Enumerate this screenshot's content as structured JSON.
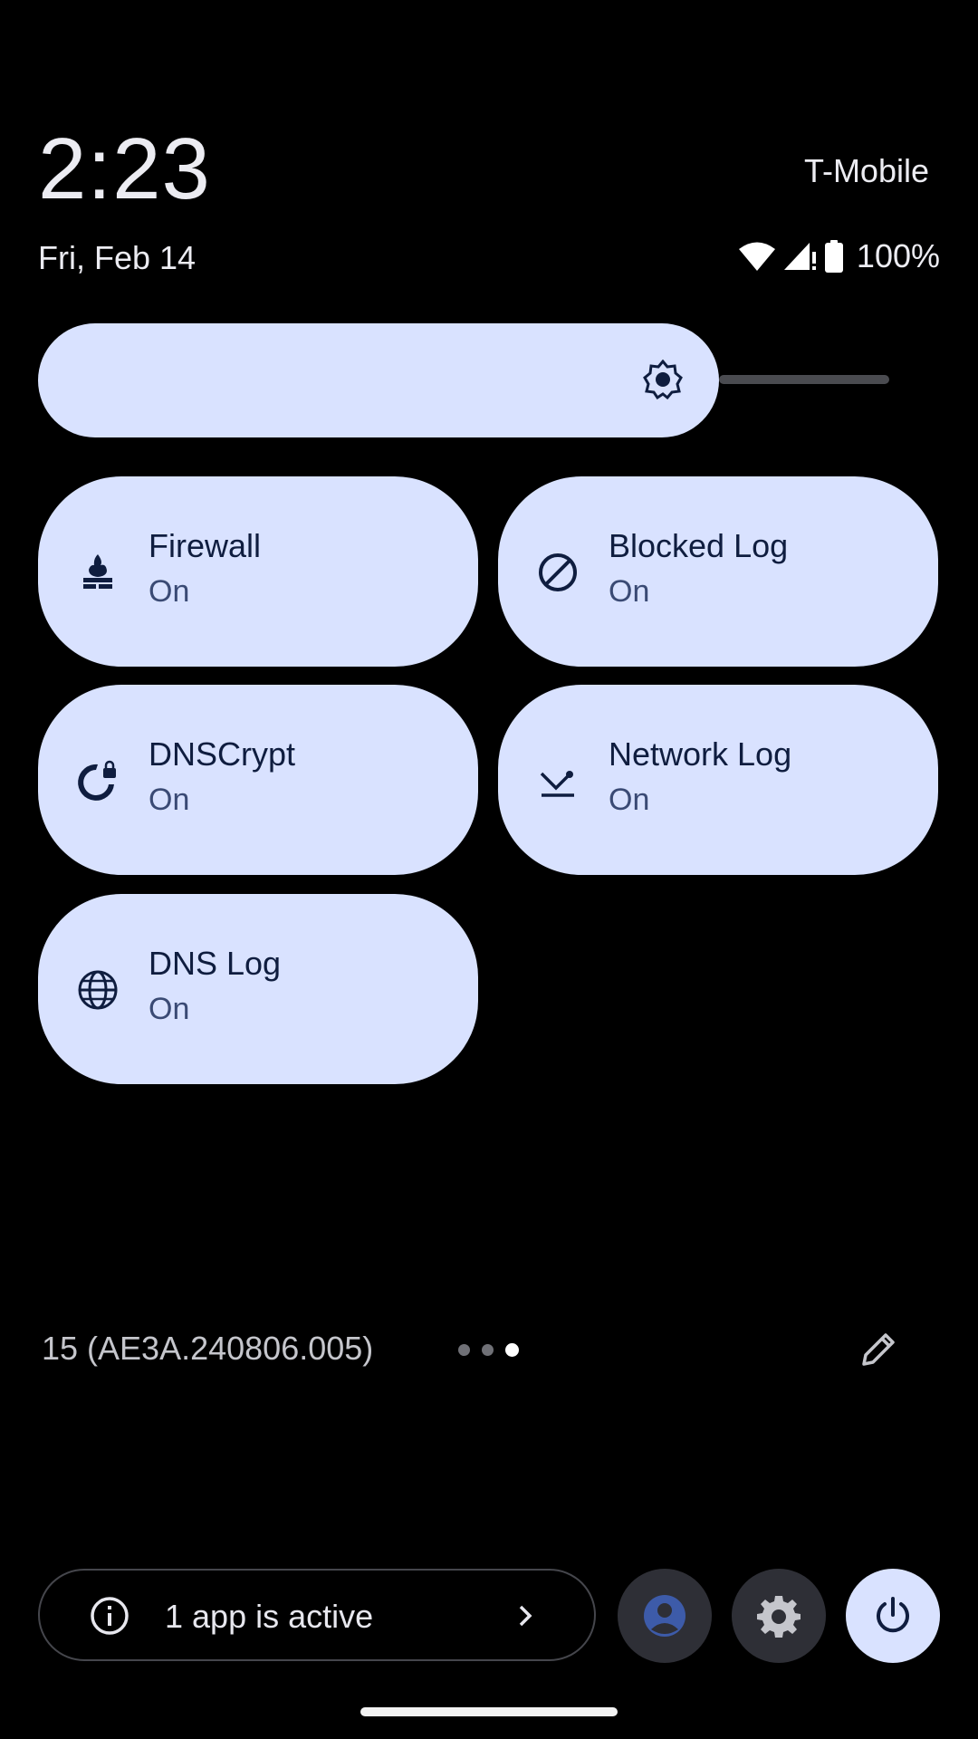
{
  "status": {
    "time": "2:23",
    "date": "Fri, Feb 14",
    "carrier": "T-Mobile",
    "battery": "100%"
  },
  "brightness": {
    "level_percent": 78
  },
  "tiles": [
    {
      "label": "Firewall",
      "state": "On",
      "icon": "firewall-icon"
    },
    {
      "label": "Blocked Log",
      "state": "On",
      "icon": "block-icon"
    },
    {
      "label": "DNSCrypt",
      "state": "On",
      "icon": "globe-lock-icon"
    },
    {
      "label": "Network Log",
      "state": "On",
      "icon": "network-log-icon"
    },
    {
      "label": "DNS Log",
      "state": "On",
      "icon": "globe-icon"
    }
  ],
  "footer": {
    "build": "15 (AE3A.240806.005)",
    "page_count": 3,
    "active_page": 3
  },
  "bottom": {
    "active_apps_label": "1 app is active"
  },
  "colors": {
    "tile_bg": "#d9e2ff",
    "tile_text": "#0f1d3f",
    "background": "#000000"
  }
}
